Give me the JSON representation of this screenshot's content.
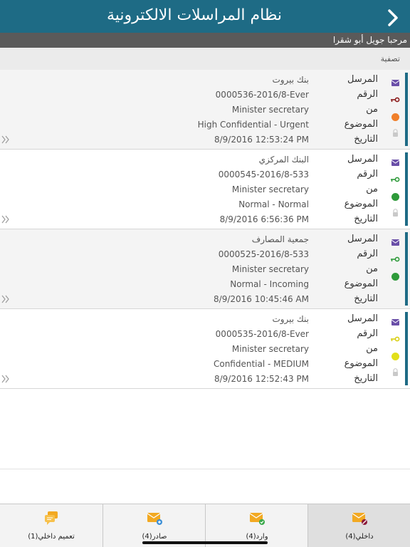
{
  "header": {
    "title": "نظام المراسلات الالكترونية"
  },
  "welcome": {
    "text": "مرحبا جويل أبو شقرا"
  },
  "filter": {
    "label": "تصفية"
  },
  "field_labels": {
    "sender": "المرسل",
    "number": "الرقم",
    "from": "من",
    "subject": "الموضوع",
    "date": "التاريخ"
  },
  "messages": [
    {
      "sender": "بنك بيروت",
      "number": "0000536-2016/8-Ever",
      "from": "Minister secretary",
      "subject": "High Confidential - Urgent",
      "date": "8/9/2016 12:53:24 PM",
      "key_color": "#8b1a1a",
      "status_color": "#f07f2a",
      "locked": true
    },
    {
      "sender": "البنك المركزي",
      "number": "0000545-2016/8-533",
      "from": "Minister secretary",
      "subject": "Normal - Normal",
      "date": "8/9/2016 6:56:36 PM",
      "key_color": "#2e9a3a",
      "status_color": "#2e9a3a",
      "locked": true
    },
    {
      "sender": "جمعية المصارف",
      "number": "0000525-2016/8-533",
      "from": "Minister secretary",
      "subject": "Normal - Incoming",
      "date": "8/9/2016 10:45:46 AM",
      "key_color": "#2e9a3a",
      "status_color": "#2e9a3a",
      "locked": false
    },
    {
      "sender": "بنك بيروت",
      "number": "0000535-2016/8-Ever",
      "from": "Minister secretary",
      "subject": "Confidential - MEDIUM",
      "date": "8/9/2016 12:52:43 PM",
      "key_color": "#d8cf12",
      "status_color": "#e2df1a",
      "locked": true
    }
  ],
  "tabs": [
    {
      "label": "تعميم داخلي(1)",
      "icon": "chat-bubbles-icon",
      "active": false
    },
    {
      "label": "صادر(4)",
      "icon": "outgoing-mail-icon",
      "active": false
    },
    {
      "label": "وارد(4)",
      "icon": "incoming-mail-icon",
      "active": false
    },
    {
      "label": "داخلي(4)",
      "icon": "internal-mail-icon",
      "active": true
    }
  ],
  "colors": {
    "header": "#1e6b85",
    "accent_bar": "#1e6b85",
    "envelope": "#6a4fa8",
    "welcome_bar": "#5a5a5a"
  }
}
